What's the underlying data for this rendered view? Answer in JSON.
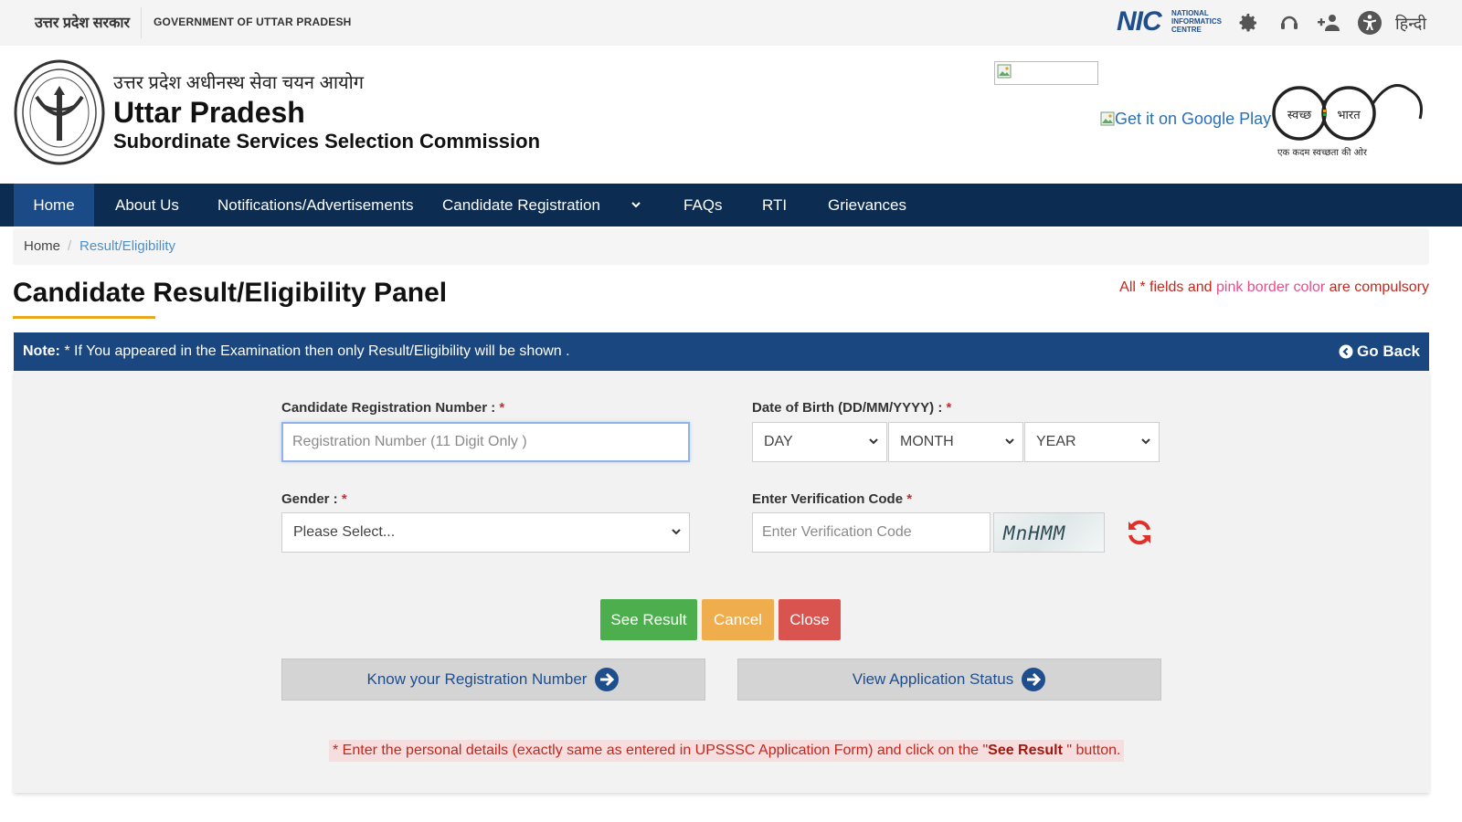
{
  "topbar": {
    "gov_hindi": "उत्तर प्रदेश सरकार",
    "gov_english": "GOVERNMENT OF UTTAR PRADESH",
    "nic_logo": "NIC",
    "nic_full": "NATIONAL INFORMATICS CENTRE",
    "icons": [
      "gear-icon",
      "headset-icon",
      "add-user-icon",
      "accessibility-icon"
    ],
    "language_link": "हिन्दी"
  },
  "header": {
    "org_hindi": "उत्तर प्रदेश अधीनस्थ सेवा चयन आयोग",
    "org_name": "Uttar Pradesh",
    "org_subtitle": "Subordinate Services Selection Commission",
    "google_play_alt": "Get it on Google Play",
    "swachh_left": "स्वच्छ",
    "swachh_right": "भारत",
    "swachh_tagline": "एक कदम स्वच्छता की ओर"
  },
  "nav": {
    "items": [
      "Home",
      "About Us",
      "Notifications/Advertisements",
      "Candidate Registration",
      "FAQs",
      "RTI",
      "Grievances"
    ],
    "active": "Home"
  },
  "breadcrumb": {
    "home": "Home",
    "separator": "/",
    "current": "Result/Eligibility"
  },
  "page": {
    "title": "Candidate Result/Eligibility Panel",
    "compulsory_pre": "All * fields and ",
    "compulsory_pink": "pink border color",
    "compulsory_post": " are compulsory"
  },
  "panel": {
    "note_label": "Note:",
    "note_text": " * If You appeared in the Examination then only Result/Eligibility will be shown .",
    "go_back": "Go Back"
  },
  "form": {
    "reg_label": "Candidate Registration Number : ",
    "reg_placeholder": "Registration Number (11 Digit Only )",
    "dob_label": "Date of Birth (DD/MM/YYYY) : ",
    "day": "DAY",
    "month": "MONTH",
    "year": "YEAR",
    "gender_label": "Gender : ",
    "gender_value": "Please Select...",
    "verify_label": "Enter Verification Code ",
    "verify_placeholder": "Enter Verification Code",
    "captcha": "MnHMM",
    "required_mark": "*"
  },
  "buttons": {
    "see_result": "See Result",
    "cancel": "Cancel",
    "close": "Close",
    "know_reg": "Know your Registration Number",
    "view_status": "View Application Status"
  },
  "footnote": {
    "pre": "* Enter the personal details (exactly same as entered in UPSSSC Application Form) and click on the \"",
    "bold": "See Result",
    "post": " \" button."
  },
  "colors": {
    "nav_bg": "#0c2c52",
    "note_bar": "#1a4780",
    "accent_gold": "#e5a81e",
    "btn_green": "#4cae4c",
    "btn_orange": "#f0ad4e",
    "btn_red": "#d9534f",
    "required_red": "#d9262b"
  }
}
